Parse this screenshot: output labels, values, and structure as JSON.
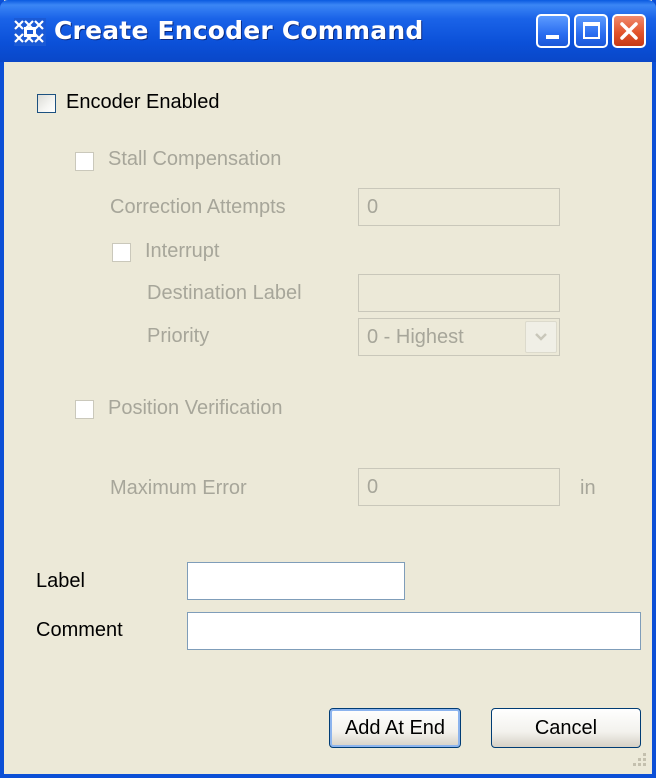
{
  "window": {
    "title": "Create Encoder Command",
    "controls": {
      "minimize": "minimize-icon",
      "maximize": "maximize-icon",
      "close": "close-icon"
    }
  },
  "encoder": {
    "enabled_label": "Encoder Enabled",
    "enabled": false,
    "stall": {
      "label": "Stall Compensation",
      "correction_attempts_label": "Correction Attempts",
      "correction_attempts_value": "0",
      "interrupt_label": "Interrupt",
      "destination_label_label": "Destination Label",
      "destination_label_value": "",
      "priority_label": "Priority",
      "priority_value": "0 - Highest"
    },
    "position": {
      "label": "Position Verification",
      "max_error_label": "Maximum Error",
      "max_error_value": "0",
      "unit": "in"
    }
  },
  "form": {
    "label_label": "Label",
    "label_value": "",
    "comment_label": "Comment",
    "comment_value": ""
  },
  "buttons": {
    "add_at_end": "Add At End",
    "cancel": "Cancel"
  },
  "colors": {
    "titlebar": "#0b50d8",
    "dialog_bg": "#ece9d8",
    "disabled_text": "#a7a69a"
  }
}
